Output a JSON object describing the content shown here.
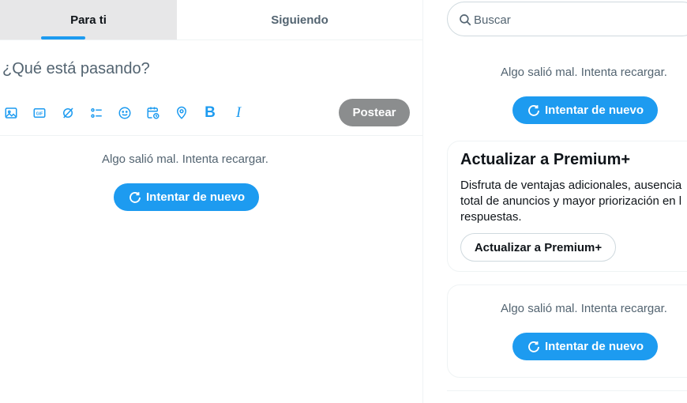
{
  "tabs": [
    {
      "label": "Para ti",
      "active": true
    },
    {
      "label": "Siguiendo",
      "active": false
    }
  ],
  "composer": {
    "placeholder": "¿Qué está pasando?",
    "tools": [
      "image-icon",
      "gif-icon",
      "grok-icon",
      "poll-icon",
      "emoji-icon",
      "schedule-icon",
      "location-icon",
      "bold-icon",
      "italic-icon"
    ],
    "bold_glyph": "B",
    "italic_glyph": "I",
    "post_label": "Postear"
  },
  "main_error": {
    "message": "Algo salió mal. Intenta recargar.",
    "retry_label": "Intentar de nuevo"
  },
  "search": {
    "placeholder": "Buscar"
  },
  "sidebar_error_1": {
    "message": "Algo salió mal. Intenta recargar.",
    "retry_label": "Intentar de nuevo"
  },
  "premium": {
    "title": "Actualizar a Premium+",
    "description": "Disfruta de ventajas adicionales, ausencia\ntotal de anuncios y mayor priorización en l\nrespuestas.",
    "button_label": "Actualizar a Premium+"
  },
  "sidebar_error_2": {
    "message": "Algo salió mal. Intenta recargar.",
    "retry_label": "Intentar de nuevo"
  },
  "colors": {
    "accent": "#1d9bf0",
    "post_disabled": "#8b8d8e",
    "secondary_text": "#536471"
  }
}
